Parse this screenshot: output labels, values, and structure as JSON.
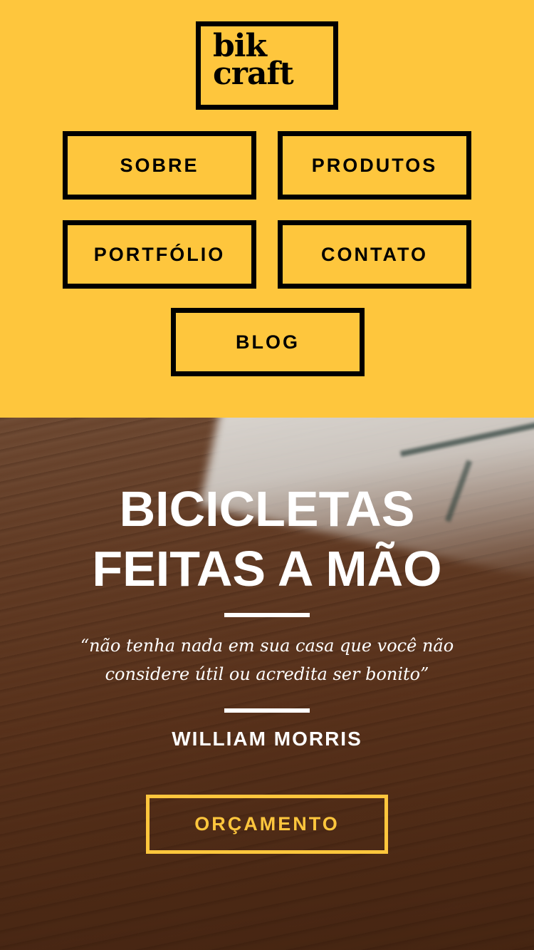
{
  "logo": {
    "line1": "bik",
    "line2": "craft"
  },
  "nav": {
    "sobre": "SOBRE",
    "produtos": "PRODUTOS",
    "portfolio": "PORTFÓLIO",
    "contato": "CONTATO",
    "blog": "BLOG"
  },
  "hero": {
    "title_line1": "BICICLETAS",
    "title_line2": "FEITAS A MÃO",
    "quote_line1": "“não tenha nada em sua casa que você não",
    "quote_line2": "considere útil ou acredita ser bonito”",
    "author": "WILLIAM MORRIS",
    "cta_label": "ORÇAMENTO"
  },
  "colors": {
    "accent": "#FEC63D",
    "ink": "#000000",
    "hero_text": "#FFFFFF"
  }
}
